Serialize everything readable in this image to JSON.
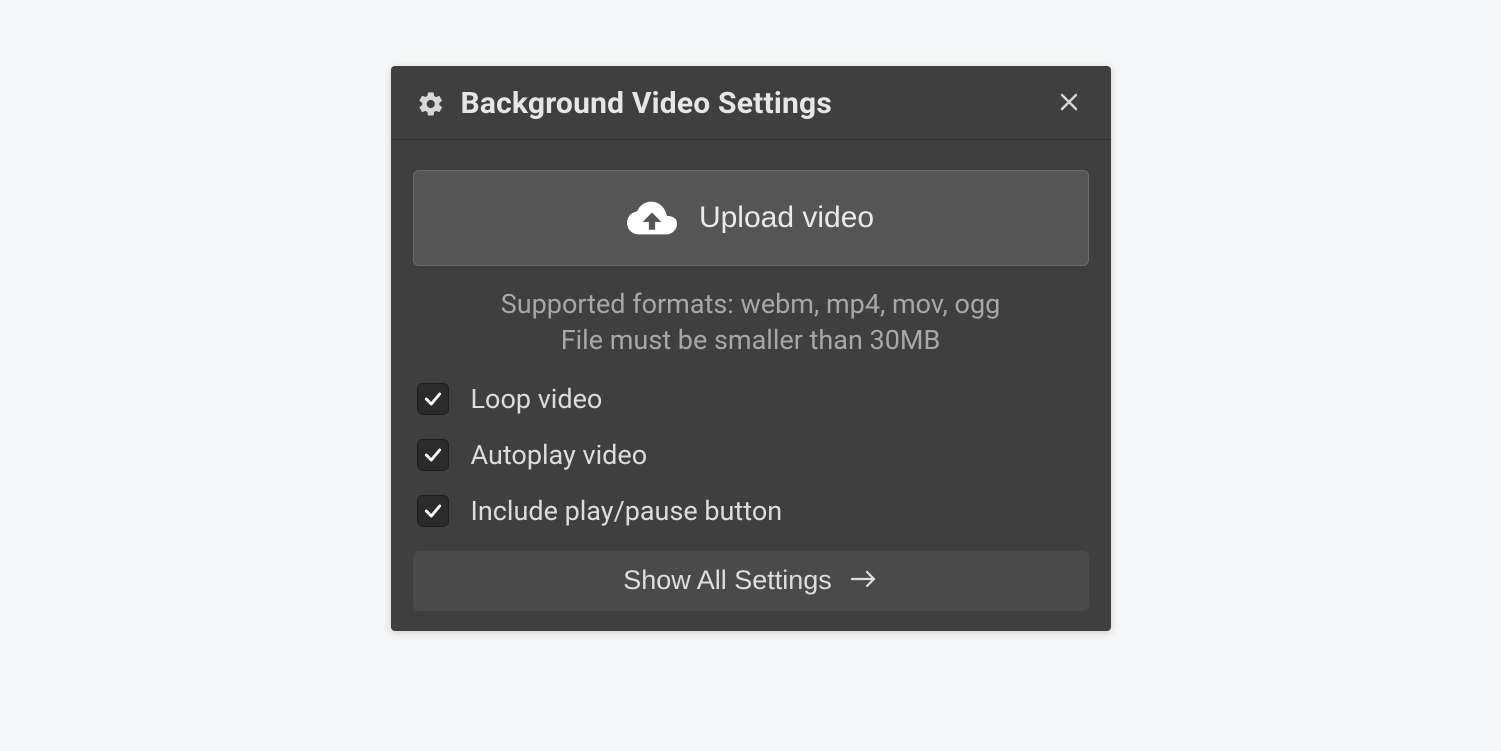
{
  "panel": {
    "title": "Background Video Settings",
    "upload_label": "Upload video",
    "hint_line1": "Supported formats: webm, mp4, mov, ogg",
    "hint_line2": "File must be smaller than 30MB",
    "options": [
      {
        "label": "Loop video",
        "checked": true
      },
      {
        "label": "Autoplay video",
        "checked": true
      },
      {
        "label": "Include play/pause button",
        "checked": true
      }
    ],
    "show_all_label": "Show All Settings"
  }
}
